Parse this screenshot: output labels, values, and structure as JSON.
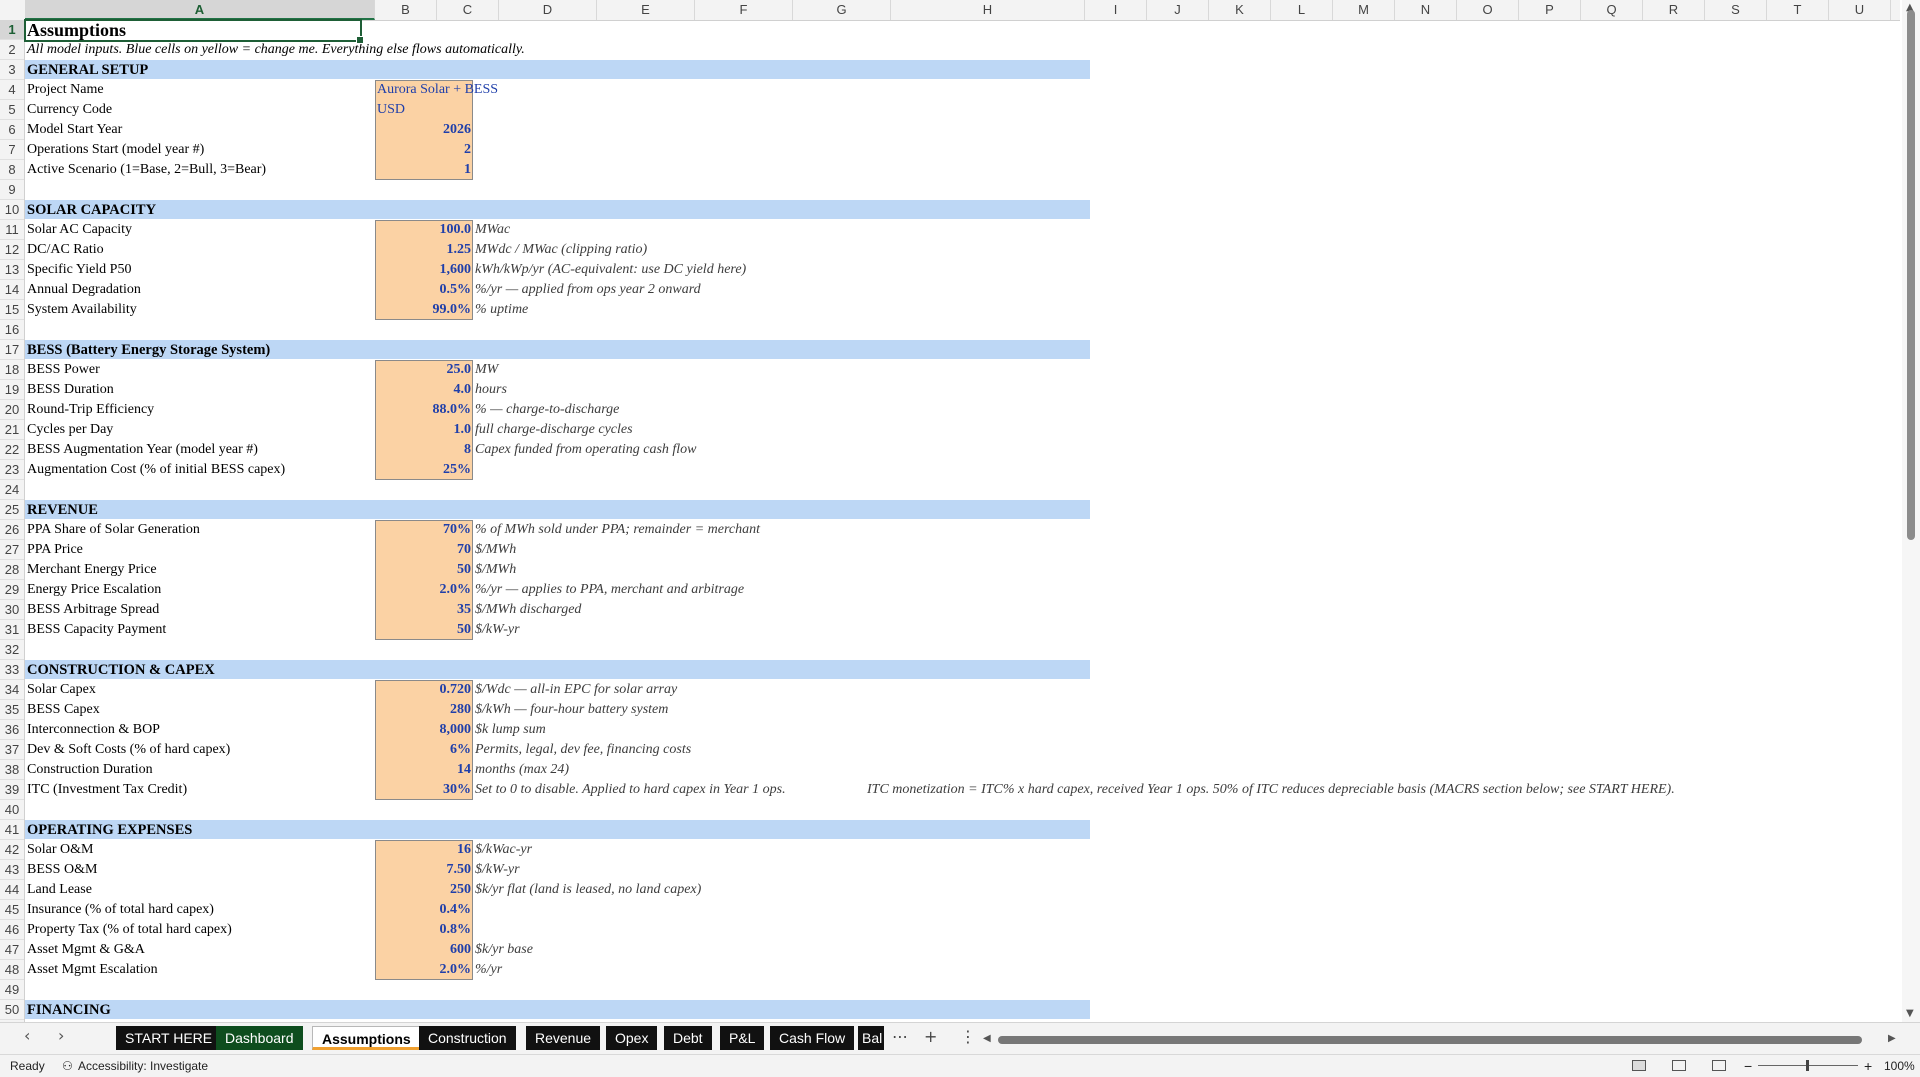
{
  "columns": [
    "A",
    "B",
    "C",
    "D",
    "E",
    "F",
    "G",
    "H",
    "I",
    "J",
    "K",
    "L",
    "M",
    "N",
    "O",
    "P",
    "Q",
    "R",
    "S",
    "T",
    "U"
  ],
  "row_numbers": [
    1,
    2,
    3,
    4,
    5,
    6,
    7,
    8,
    9,
    10,
    11,
    12,
    13,
    14,
    15,
    16,
    17,
    18,
    19,
    20,
    21,
    22,
    23,
    24,
    25,
    26,
    27,
    28,
    29,
    30,
    31,
    32,
    33,
    34,
    35,
    36,
    37,
    38,
    39,
    40,
    41,
    42,
    43,
    44,
    45,
    46,
    47,
    48,
    49,
    50
  ],
  "title": "Assumptions",
  "subtitle": "All model inputs. Blue cells on yellow = change me. Everything else flows automatically.",
  "sections": {
    "general": "GENERAL SETUP",
    "solar": "SOLAR CAPACITY",
    "bess": "BESS (Battery Energy Storage System)",
    "revenue": "REVENUE",
    "capex": "CONSTRUCTION & CAPEX",
    "opex": "OPERATING EXPENSES",
    "financing": "FINANCING"
  },
  "rows": {
    "r4": {
      "label": "Project Name",
      "value": "Aurora Solar + BESS",
      "note": ""
    },
    "r5": {
      "label": "Currency Code",
      "value": "USD",
      "note": ""
    },
    "r6": {
      "label": "Model Start Year",
      "value": "2026",
      "note": ""
    },
    "r7": {
      "label": "Operations Start (model year #)",
      "value": "2",
      "note": ""
    },
    "r8": {
      "label": "Active Scenario (1=Base, 2=Bull, 3=Bear)",
      "value": "1",
      "note": ""
    },
    "r11": {
      "label": "Solar AC Capacity",
      "value": "100.0",
      "note": "MWac"
    },
    "r12": {
      "label": "DC/AC Ratio",
      "value": "1.25",
      "note": "MWdc / MWac (clipping ratio)"
    },
    "r13": {
      "label": "Specific Yield P50",
      "value": "1,600",
      "note": "kWh/kWp/yr (AC-equivalent: use DC yield here)"
    },
    "r14": {
      "label": "Annual Degradation",
      "value": "0.5%",
      "note": "%/yr — applied from ops year 2 onward"
    },
    "r15": {
      "label": "System Availability",
      "value": "99.0%",
      "note": "% uptime"
    },
    "r18": {
      "label": "BESS Power",
      "value": "25.0",
      "note": "MW"
    },
    "r19": {
      "label": "BESS Duration",
      "value": "4.0",
      "note": "hours"
    },
    "r20": {
      "label": "Round-Trip Efficiency",
      "value": "88.0%",
      "note": "% — charge-to-discharge"
    },
    "r21": {
      "label": "Cycles per Day",
      "value": "1.0",
      "note": "full charge-discharge cycles"
    },
    "r22": {
      "label": "BESS Augmentation Year (model year #)",
      "value": "8",
      "note": "Capex funded from operating cash flow"
    },
    "r23": {
      "label": "Augmentation Cost (% of initial BESS capex)",
      "value": "25%",
      "note": ""
    },
    "r26": {
      "label": "PPA Share of Solar Generation",
      "value": "70%",
      "note": "% of MWh sold under PPA; remainder = merchant"
    },
    "r27": {
      "label": "PPA Price",
      "value": "70",
      "note": "$/MWh"
    },
    "r28": {
      "label": "Merchant Energy Price",
      "value": "50",
      "note": "$/MWh"
    },
    "r29": {
      "label": "Energy Price Escalation",
      "value": "2.0%",
      "note": "%/yr — applies to PPA, merchant and arbitrage"
    },
    "r30": {
      "label": "BESS Arbitrage Spread",
      "value": "35",
      "note": "$/MWh discharged"
    },
    "r31": {
      "label": "BESS Capacity Payment",
      "value": "50",
      "note": "$/kW-yr"
    },
    "r34": {
      "label": "Solar Capex",
      "value": "0.720",
      "note": "$/Wdc — all-in EPC for solar array"
    },
    "r35": {
      "label": "BESS Capex",
      "value": "280",
      "note": "$/kWh — four-hour battery system"
    },
    "r36": {
      "label": "Interconnection & BOP",
      "value": "8,000",
      "note": "$k lump sum"
    },
    "r37": {
      "label": "Dev & Soft Costs (% of hard capex)",
      "value": "6%",
      "note": "Permits, legal, dev fee, financing costs"
    },
    "r38": {
      "label": "Construction Duration",
      "value": "14",
      "note": "months (max 24)"
    },
    "r39": {
      "label": "ITC (Investment Tax Credit)",
      "value": "30%",
      "note": "Set to 0 to disable. Applied to hard capex in Year 1 ops.",
      "note2": "ITC monetization = ITC% x hard capex, received Year 1 ops. 50% of ITC reduces depreciable basis (MACRS section below; see START HERE)."
    },
    "r42": {
      "label": "Solar O&M",
      "value": "16",
      "note": "$/kWac-yr"
    },
    "r43": {
      "label": "BESS O&M",
      "value": "7.50",
      "note": "$/kW-yr"
    },
    "r44": {
      "label": "Land Lease",
      "value": "250",
      "note": "$k/yr flat (land is leased, no land capex)"
    },
    "r45": {
      "label": "Insurance (% of total hard capex)",
      "value": "0.4%",
      "note": ""
    },
    "r46": {
      "label": "Property Tax (% of total hard capex)",
      "value": "0.8%",
      "note": ""
    },
    "r47": {
      "label": "Asset Mgmt & G&A",
      "value": "600",
      "note": "$k/yr base"
    },
    "r48": {
      "label": "Asset Mgmt Escalation",
      "value": "2.0%",
      "note": "%/yr"
    }
  },
  "tabs": [
    "START HERE",
    "Dashboard",
    "Assumptions",
    "Construction",
    "Revenue",
    "Opex",
    "Debt",
    "P&L",
    "Cash Flow",
    "Bal"
  ],
  "active_tab": "Assumptions",
  "status": {
    "ready": "Ready",
    "accessibility": "Accessibility: Investigate",
    "zoom": "100%"
  },
  "colors": {
    "header_band": "#bdd7f5",
    "input_fill": "#fbd2a4",
    "input_text": "#1f3faa",
    "dashboard_tab": "#0e4d1e",
    "selection": "#1e5e36"
  }
}
